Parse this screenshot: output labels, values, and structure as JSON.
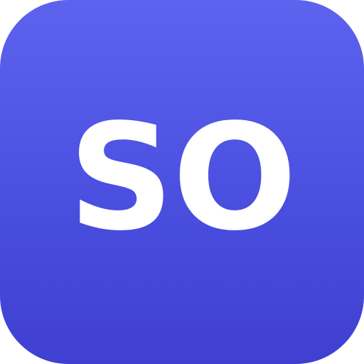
{
  "icon": {
    "monogram_text": "SO",
    "colors": {
      "gradient_top": "#5d63ee",
      "gradient_bottom": "#3f3fd1",
      "text": "#ffffff"
    }
  }
}
